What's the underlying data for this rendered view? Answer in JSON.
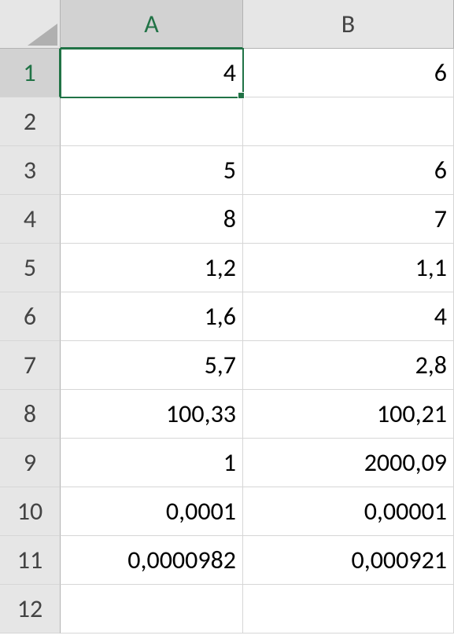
{
  "columns": [
    "A",
    "B"
  ],
  "rows": [
    "1",
    "2",
    "3",
    "4",
    "5",
    "6",
    "7",
    "8",
    "9",
    "10",
    "11",
    "12"
  ],
  "selected": {
    "row": 0,
    "col": 0
  },
  "cells": [
    [
      "4",
      "6"
    ],
    [
      "",
      ""
    ],
    [
      "5",
      "6"
    ],
    [
      "8",
      "7"
    ],
    [
      "1,2",
      "1,1"
    ],
    [
      "1,6",
      "4"
    ],
    [
      "5,7",
      "2,8"
    ],
    [
      "100,33",
      "100,21"
    ],
    [
      "1",
      "2000,09"
    ],
    [
      "0,0001",
      "0,00001"
    ],
    [
      "0,0000982",
      "0,000921"
    ],
    [
      "",
      ""
    ]
  ]
}
